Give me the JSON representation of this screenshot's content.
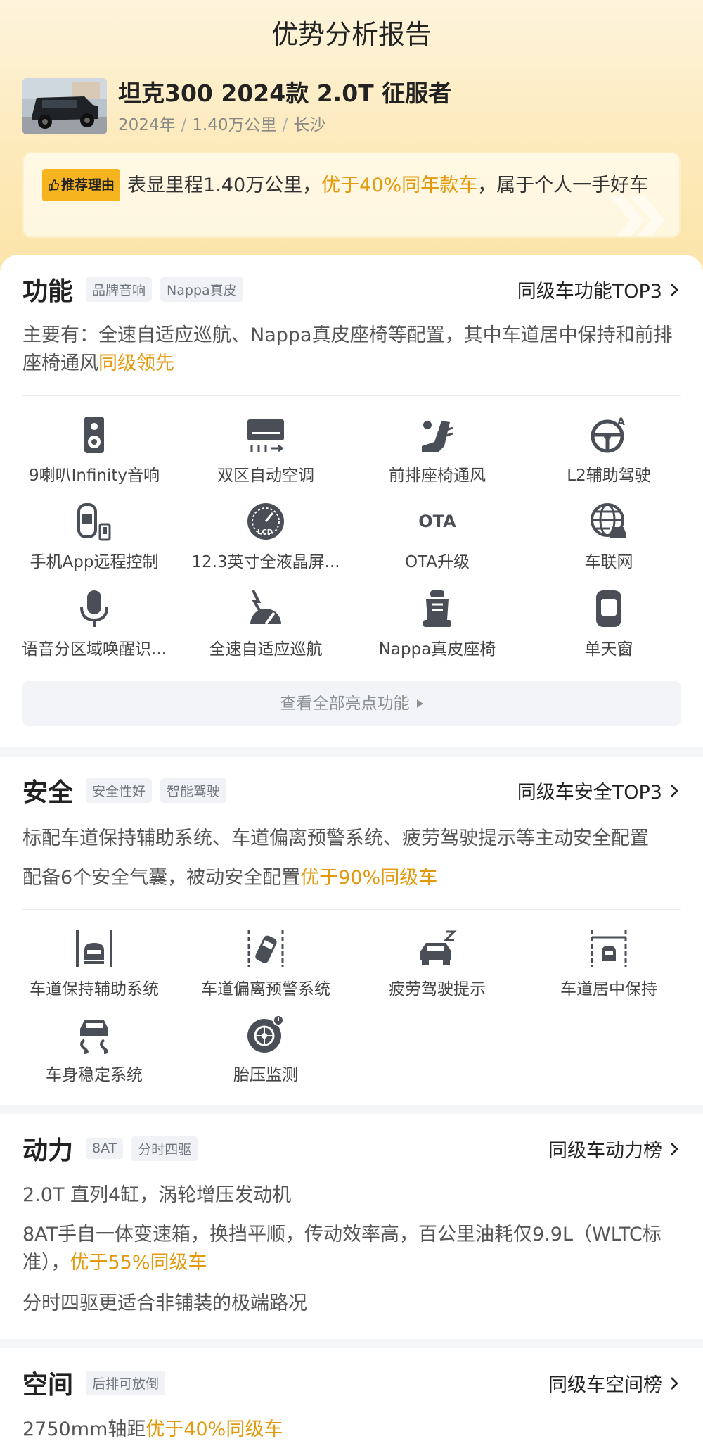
{
  "header": {
    "title": "优势分析报告",
    "car_name": "坦克300 2024款 2.0T 征服者",
    "meta": [
      "2024年",
      "1.40万公里",
      "长沙"
    ],
    "reason_badge": "推荐理由",
    "reason_pre": "表显里程1.40万公里，",
    "reason_hl": "优于40%同年款车",
    "reason_post": "，属于个人一手好车"
  },
  "function": {
    "title": "功能",
    "tags": [
      "品牌音响",
      "Nappa真皮"
    ],
    "link": "同级车功能TOP3",
    "desc_pre": "主要有：全速自适应巡航、Nappa真皮座椅等配置，其中车道居中保持和前排座椅通风",
    "desc_hl": "同级领先",
    "features": [
      {
        "label": "9喇叭Infinity音响",
        "icon": "speaker-icon"
      },
      {
        "label": "双区自动空调",
        "icon": "air-conditioner-icon"
      },
      {
        "label": "前排座椅通风",
        "icon": "seat-ventilation-icon"
      },
      {
        "label": "L2辅助驾驶",
        "icon": "assisted-driving-icon"
      },
      {
        "label": "手机App远程控制",
        "icon": "phone-remote-icon"
      },
      {
        "label": "12.3英寸全液晶屏...",
        "icon": "lcd-gauge-icon"
      },
      {
        "label": "OTA升级",
        "icon": "ota-icon"
      },
      {
        "label": "车联网",
        "icon": "connected-car-icon"
      },
      {
        "label": "语音分区域唤醒识...",
        "icon": "microphone-icon"
      },
      {
        "label": "全速自适应巡航",
        "icon": "cruise-control-icon"
      },
      {
        "label": "Nappa真皮座椅",
        "icon": "leather-seat-icon"
      },
      {
        "label": "单天窗",
        "icon": "sunroof-icon"
      }
    ],
    "ota_text": "OTA",
    "lcd_text": "LCD",
    "more_label": "查看全部亮点功能"
  },
  "safety": {
    "title": "安全",
    "tags": [
      "安全性好",
      "智能驾驶"
    ],
    "link": "同级车安全TOP3",
    "desc1": "标配车道保持辅助系统、车道偏离预警系统、疲劳驾驶提示等主动安全配置",
    "desc2_pre": "配备6个安全气囊，被动安全配置",
    "desc2_hl": "优于90%同级车",
    "features": [
      {
        "label": "车道保持辅助系统",
        "icon": "lane-keep-icon"
      },
      {
        "label": "车道偏离预警系统",
        "icon": "lane-departure-icon"
      },
      {
        "label": "疲劳驾驶提示",
        "icon": "fatigue-alert-icon"
      },
      {
        "label": "车道居中保持",
        "icon": "lane-center-icon"
      },
      {
        "label": "车身稳定系统",
        "icon": "stability-control-icon"
      },
      {
        "label": "胎压监测",
        "icon": "tire-pressure-icon"
      }
    ]
  },
  "power": {
    "title": "动力",
    "tags": [
      "8AT",
      "分时四驱"
    ],
    "link": "同级车动力榜",
    "line1": "2.0T 直列4缸，涡轮增压发动机",
    "line2_pre": "8AT手自一体变速箱，换挡平顺，传动效率高，百公里油耗仅9.9L（WLTC标准），",
    "line2_hl": "优于55%同级车",
    "line3": "分时四驱更适合非铺装的极端路况"
  },
  "space": {
    "title": "空间",
    "tags": [
      "后排可放倒"
    ],
    "link": "同级车空间榜",
    "line1_pre": "2750mm轴距",
    "line1_hl": "优于40%同级车"
  },
  "colors": {
    "accent": "#e29a0c",
    "badge": "#f6b51e",
    "icon": "#4a4f57"
  }
}
